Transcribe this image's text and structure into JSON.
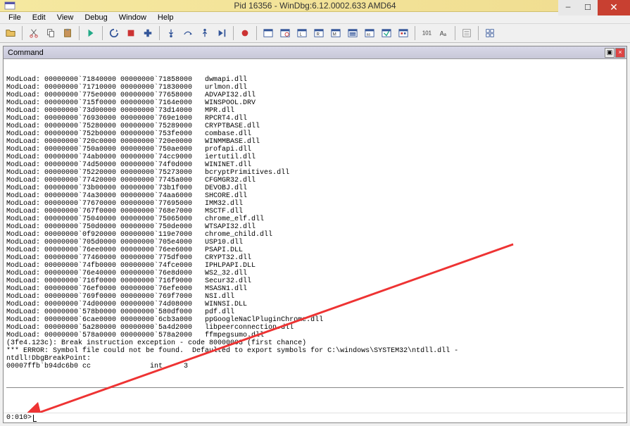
{
  "window": {
    "title": "Pid 16356 - WinDbg:6.12.0002.633 AMD64"
  },
  "menu": {
    "file": "File",
    "edit": "Edit",
    "view": "View",
    "debug": "Debug",
    "window": "Window",
    "help": "Help"
  },
  "command_panel": {
    "title": "Command",
    "prompt": "0:010> "
  },
  "log_lines": [
    "ModLoad: 00000000`71840000 00000000`71858000   dwmapi.dll",
    "ModLoad: 00000000`71710000 00000000`71830000   urlmon.dll",
    "ModLoad: 00000000`775e0000 00000000`77658000   ADVAPI32.dll",
    "ModLoad: 00000000`715f0000 00000000`7164e000   WINSPOOL.DRV",
    "ModLoad: 00000000`73d00000 00000000`73d14000   MPR.dll",
    "ModLoad: 00000000`76930000 00000000`769e1000   RPCRT4.dll",
    "ModLoad: 00000000`75280000 00000000`75289000   CRYPTBASE.dll",
    "ModLoad: 00000000`752b0000 00000000`753fe000   combase.dll",
    "ModLoad: 00000000`720c0000 00000000`720e0000   WINMMBASE.dll",
    "ModLoad: 00000000`750a0000 00000000`750ae000   profapi.dll",
    "ModLoad: 00000000`74ab0000 00000000`74cc9000   iertutil.dll",
    "ModLoad: 00000000`74d50000 00000000`74f0d000   WININET.dll",
    "ModLoad: 00000000`75220000 00000000`75273000   bcryptPrimitives.dll",
    "ModLoad: 00000000`77420000 00000000`7745a000   CFGMGR32.dll",
    "ModLoad: 00000000`73b00000 00000000`73b1f000   DEVOBJ.dll",
    "ModLoad: 00000000`74a30000 00000000`74aa6000   SHCORE.dll",
    "ModLoad: 00000000`77670000 00000000`77695000   IMM32.dll",
    "ModLoad: 00000000`767f0000 00000000`768e7000   MSCTF.dll",
    "ModLoad: 00000000`75040000 00000000`75065000   chrome_elf.dll",
    "ModLoad: 00000000`750d0000 00000000`750de000   WTSAPI32.dll",
    "ModLoad: 00000000`0f920000 00000000`119e7000   chrome_child.dll",
    "ModLoad: 00000000`705d0000 00000000`705e4000   USP10.dll",
    "ModLoad: 00000000`76ee0000 00000000`76ee6000   PSAPI.DLL",
    "ModLoad: 00000000`77460000 00000000`775df000   CRYPT32.dll",
    "ModLoad: 00000000`74fb0000 00000000`74fce000   IPHLPAPI.DLL",
    "ModLoad: 00000000`76e40000 00000000`76e8d000   WS2_32.dll",
    "ModLoad: 00000000`716f0000 00000000`716f9000   Secur32.dll",
    "ModLoad: 00000000`76ef0000 00000000`76efe000   MSASN1.dll",
    "ModLoad: 00000000`769f0000 00000000`769f7000   NSI.dll",
    "ModLoad: 00000000`74d00000 00000000`74d08000   WINNSI.DLL",
    "ModLoad: 00000000`578b0000 00000000`580df000   pdf.dll",
    "ModLoad: 00000000`6cae0000 00000000`6cb3a000   ppGoogleNaClPluginChrome.dll",
    "ModLoad: 00000000`5a280000 00000000`5a4d2000   libpeerconnection.dll",
    "ModLoad: 00000000`578a0000 00000000`578a2000   ffmpegsumo.dll",
    "(3fe4.123c): Break instruction exception - code 80000003 (first chance)",
    "*** ERROR: Symbol file could not be found.  Defaulted to export symbols for C:\\windows\\SYSTEM32\\ntdll.dll - ",
    "ntdll!DbgBreakPoint:",
    "00007ffb`b94dc6b0 cc              int     3"
  ]
}
